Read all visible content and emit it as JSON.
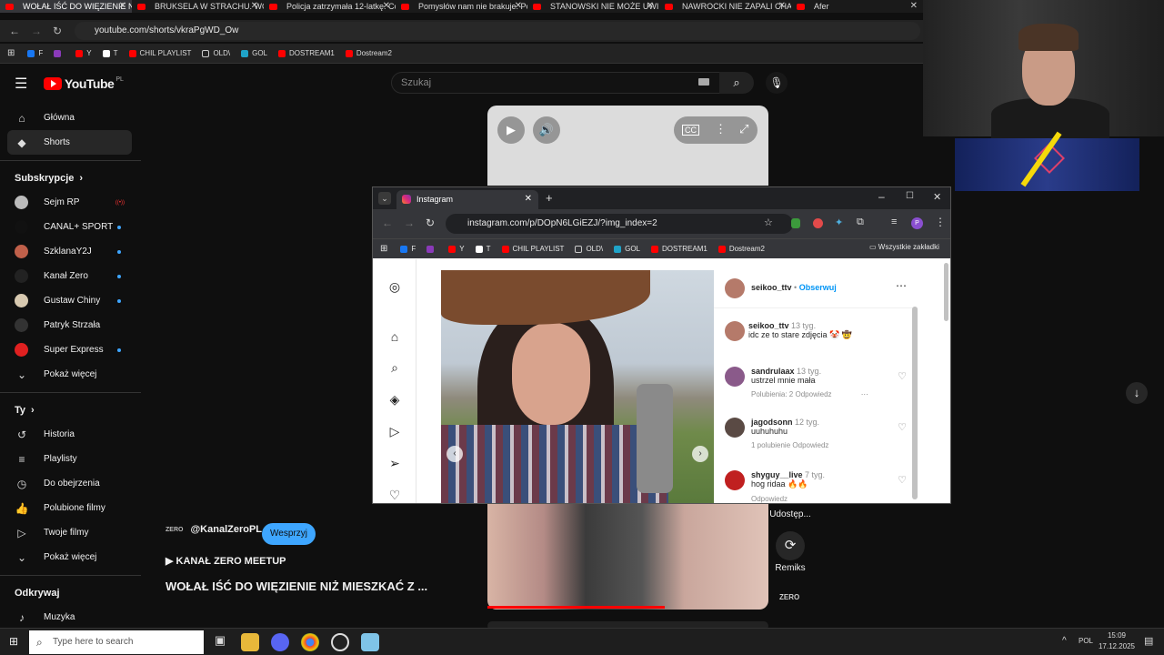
{
  "browser": {
    "tabs": [
      {
        "label": "WOŁAŁ IŚĆ DO WIĘZIENIE NIŻ",
        "active": true
      },
      {
        "label": "BRUKSELA W STRACHU. WOJNA",
        "active": false
      },
      {
        "label": "Policja zatrzymała 12-latkę. Co",
        "active": false
      },
      {
        "label": "Pomysłów nam nie brakuje. Po",
        "active": false
      },
      {
        "label": "STANOWSKI NIE MOŻE UWIER",
        "active": false
      },
      {
        "label": "NAWROCKI NIE ZAPALI CHANU",
        "active": false
      },
      {
        "label": "Afer",
        "active": false
      }
    ],
    "url": "youtube.com/shorts/vkraPgWD_Ow",
    "bookmarks": [
      "F",
      "",
      "Y",
      "T",
      "CHIL PLAYLIST",
      "OLD\\",
      "GOL",
      "DOSTREAM1",
      "Dostream2"
    ]
  },
  "youtube": {
    "logo": "YouTube",
    "region": "PL",
    "search_placeholder": "Szukaj",
    "sidebar": {
      "main": [
        {
          "label": "Główna",
          "icon": "home-icon"
        },
        {
          "label": "Shorts",
          "icon": "shorts-icon",
          "selected": true
        }
      ],
      "subs_header": "Subskrypcje",
      "subs": [
        {
          "label": "Sejm RP",
          "color": "#bbbbbb",
          "live": true
        },
        {
          "label": "CANAL+ SPORT",
          "color": "#111111",
          "dot": true
        },
        {
          "label": "SzklanaY2J",
          "color": "#c0604a",
          "dot": true
        },
        {
          "label": "Kanał Zero",
          "color": "#222222",
          "dot": true
        },
        {
          "label": "Gustaw Chiny",
          "color": "#d7c9b0",
          "dot": true
        },
        {
          "label": "Patryk Strzała",
          "color": "#333333",
          "dot": false
        },
        {
          "label": "Super Express",
          "color": "#e02020",
          "dot": true
        },
        {
          "label": "Pokaż więcej",
          "color": "",
          "dot": false
        }
      ],
      "you_header": "Ty",
      "you": [
        {
          "label": "Historia",
          "icon": "history-icon"
        },
        {
          "label": "Playlisty",
          "icon": "playlist-icon"
        },
        {
          "label": "Do obejrzenia",
          "icon": "clock-icon"
        },
        {
          "label": "Polubione filmy",
          "icon": "thumb-icon"
        },
        {
          "label": "Twoje filmy",
          "icon": "video-icon"
        },
        {
          "label": "Pokaż więcej",
          "icon": "chevron-down-icon"
        }
      ],
      "explore_header": "Odkrywaj",
      "explore": [
        {
          "label": "Muzyka",
          "icon": "music-icon"
        }
      ]
    },
    "channel_badge": "ZERO",
    "channel": "@KanalZeroPL",
    "subscribe": "Wesprzyj",
    "playlist": "KANAŁ ZERO MEETUP",
    "video_title": "WOŁAŁ IŚĆ DO WIĘZIENIE NIŻ MIESZKAĆ Z ...",
    "share": "Udostęp...",
    "remix": "Remiks",
    "progress_fraction": 0.63
  },
  "instagram_window": {
    "tab_title": "Instagram",
    "url": "instagram.com/p/DOpN6LGiEZJ/?img_index=2",
    "bookmarks": [
      "F",
      "",
      "Y",
      "T",
      "CHIL PLAYLIST",
      "OLD\\",
      "GOL",
      "DOSTREAM1",
      "Dostream2"
    ],
    "all_bookmarks": "Wszystkie zakładki",
    "post_author": "seikoo_ttv",
    "follow": "Obserwuj",
    "comments": [
      {
        "user": "seikoo_ttv",
        "time": "13 tyg.",
        "text": "idc ze to stare zdjęcia 🤡 🤠",
        "meta": "",
        "reply": "",
        "color": "#b57a6a"
      },
      {
        "user": "sandrulaax",
        "time": "13 tyg.",
        "text": "ustrzel mnie mała",
        "meta": "Polubienia: 2",
        "reply": "Odpowiedz",
        "color": "#8a5a8a"
      },
      {
        "user": "jagodsonn",
        "time": "12 tyg.",
        "text": "uuhuhuhu",
        "meta": "1 polubienie",
        "reply": "Odpowiedz",
        "color": "#5a4a44"
      },
      {
        "user": "shyguy__live",
        "time": "7 tyg.",
        "text": "hog ridaa 🔥🔥",
        "meta": "",
        "reply": "Odpowiedz",
        "color": "#c02020"
      }
    ]
  },
  "taskbar": {
    "search_placeholder": "Type here to search",
    "lang": "POL",
    "time": "15:09",
    "date": "17.12.2025"
  }
}
